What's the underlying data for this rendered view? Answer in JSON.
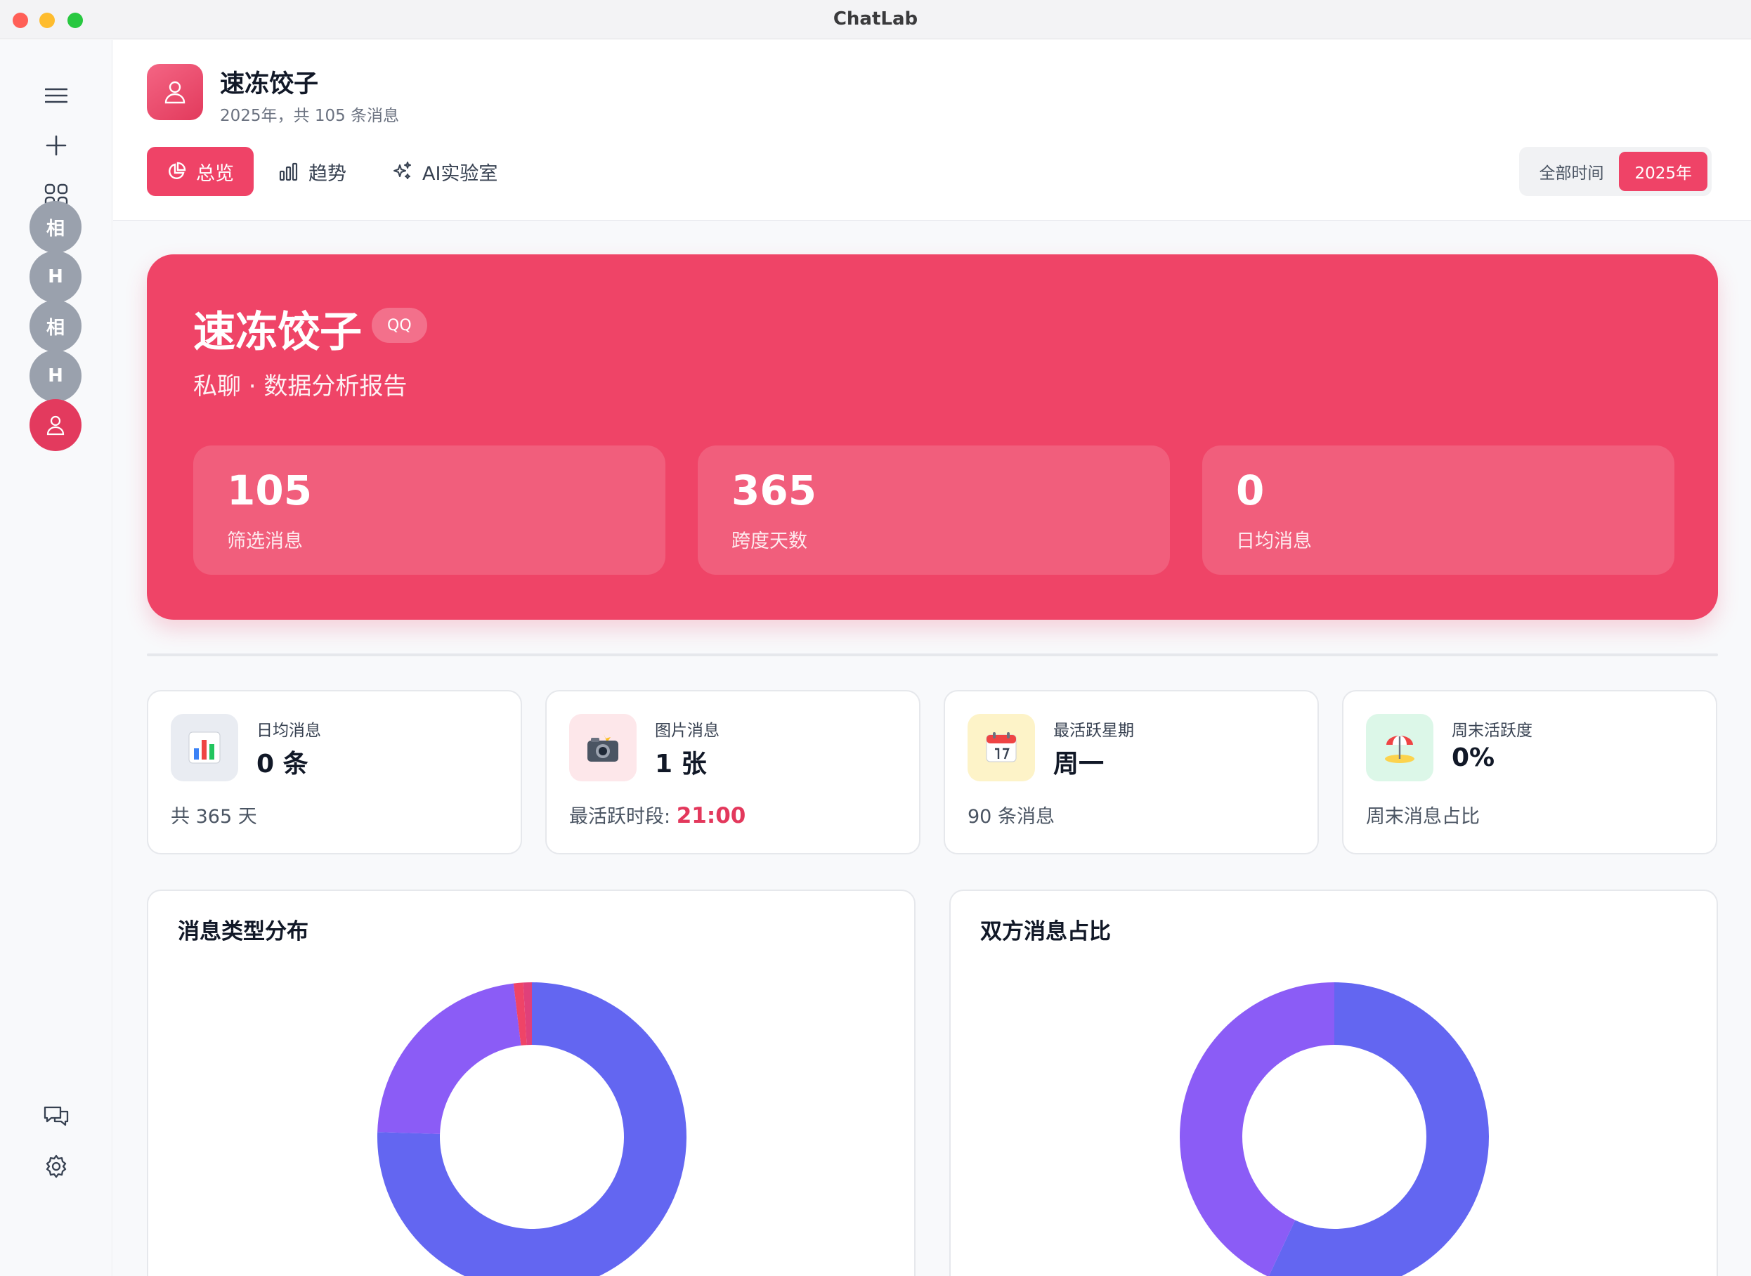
{
  "window": {
    "title": "ChatLab"
  },
  "sidebar": {
    "icons": [
      "menu-icon",
      "plus-icon",
      "apps-icon",
      "chat-bubbles-icon",
      "settings-icon"
    ],
    "avatars": [
      {
        "label": "相"
      },
      {
        "label": "H"
      },
      {
        "label": "相"
      },
      {
        "label": "H"
      },
      {
        "label": "",
        "icon": "user-icon",
        "active": true
      }
    ]
  },
  "header": {
    "name": "速冻饺子",
    "subtitle": "2025年，共 105 条消息",
    "tabs": [
      {
        "label": "总览",
        "icon": "pie-chart-icon",
        "active": true
      },
      {
        "label": "趋势",
        "icon": "bar-chart-icon",
        "active": false
      },
      {
        "label": "AI实验室",
        "icon": "sparkles-icon",
        "active": false
      }
    ],
    "range": {
      "options": [
        "全部时间",
        "2025年"
      ],
      "selected": "2025年"
    }
  },
  "hero": {
    "title": "速冻饺子",
    "badge": "QQ",
    "subtitle": "私聊 · 数据分析报告",
    "stats": [
      {
        "value": "105",
        "label": "筛选消息"
      },
      {
        "value": "365",
        "label": "跨度天数"
      },
      {
        "value": "0",
        "label": "日均消息"
      }
    ]
  },
  "cards": [
    {
      "label": "日均消息",
      "value": "0 条",
      "foot": "共 365 天",
      "icon": "bar-chart-emoji-icon",
      "icon_bg": "#e9ecf2"
    },
    {
      "label": "图片消息",
      "value": "1 张",
      "foot_prefix": "最活跃时段: ",
      "foot_accent": "21:00",
      "icon": "camera-flash-emoji-icon",
      "icon_bg": "#fde7ea"
    },
    {
      "label": "最活跃星期",
      "value": "周一",
      "foot": "90 条消息",
      "icon": "calendar-emoji-icon",
      "icon_bg": "#fdf3c8"
    },
    {
      "label": "周末活跃度",
      "value": "0%",
      "foot": "周末消息占比",
      "icon": "beach-umbrella-emoji-icon",
      "icon_bg": "#dcf7e8"
    }
  ],
  "colors": {
    "accent": "#ef4467",
    "indigo": "#6366f1",
    "purple": "#8b5cf6",
    "red": "#ef4467"
  },
  "chart_data": [
    {
      "type": "pie",
      "title": "消息类型分布",
      "donut": true,
      "slices": [
        {
          "value": 75.5,
          "color": "#6366f1"
        },
        {
          "value": 22.6,
          "color": "#8b5cf6"
        },
        {
          "value": 1.0,
          "color": "#ef4467"
        },
        {
          "value": 0.9,
          "color": "#e0407a"
        }
      ]
    },
    {
      "type": "pie",
      "title": "双方消息占比",
      "donut": true,
      "slices": [
        {
          "value": 57,
          "color": "#6366f1"
        },
        {
          "value": 43,
          "color": "#8b5cf6"
        }
      ]
    }
  ]
}
